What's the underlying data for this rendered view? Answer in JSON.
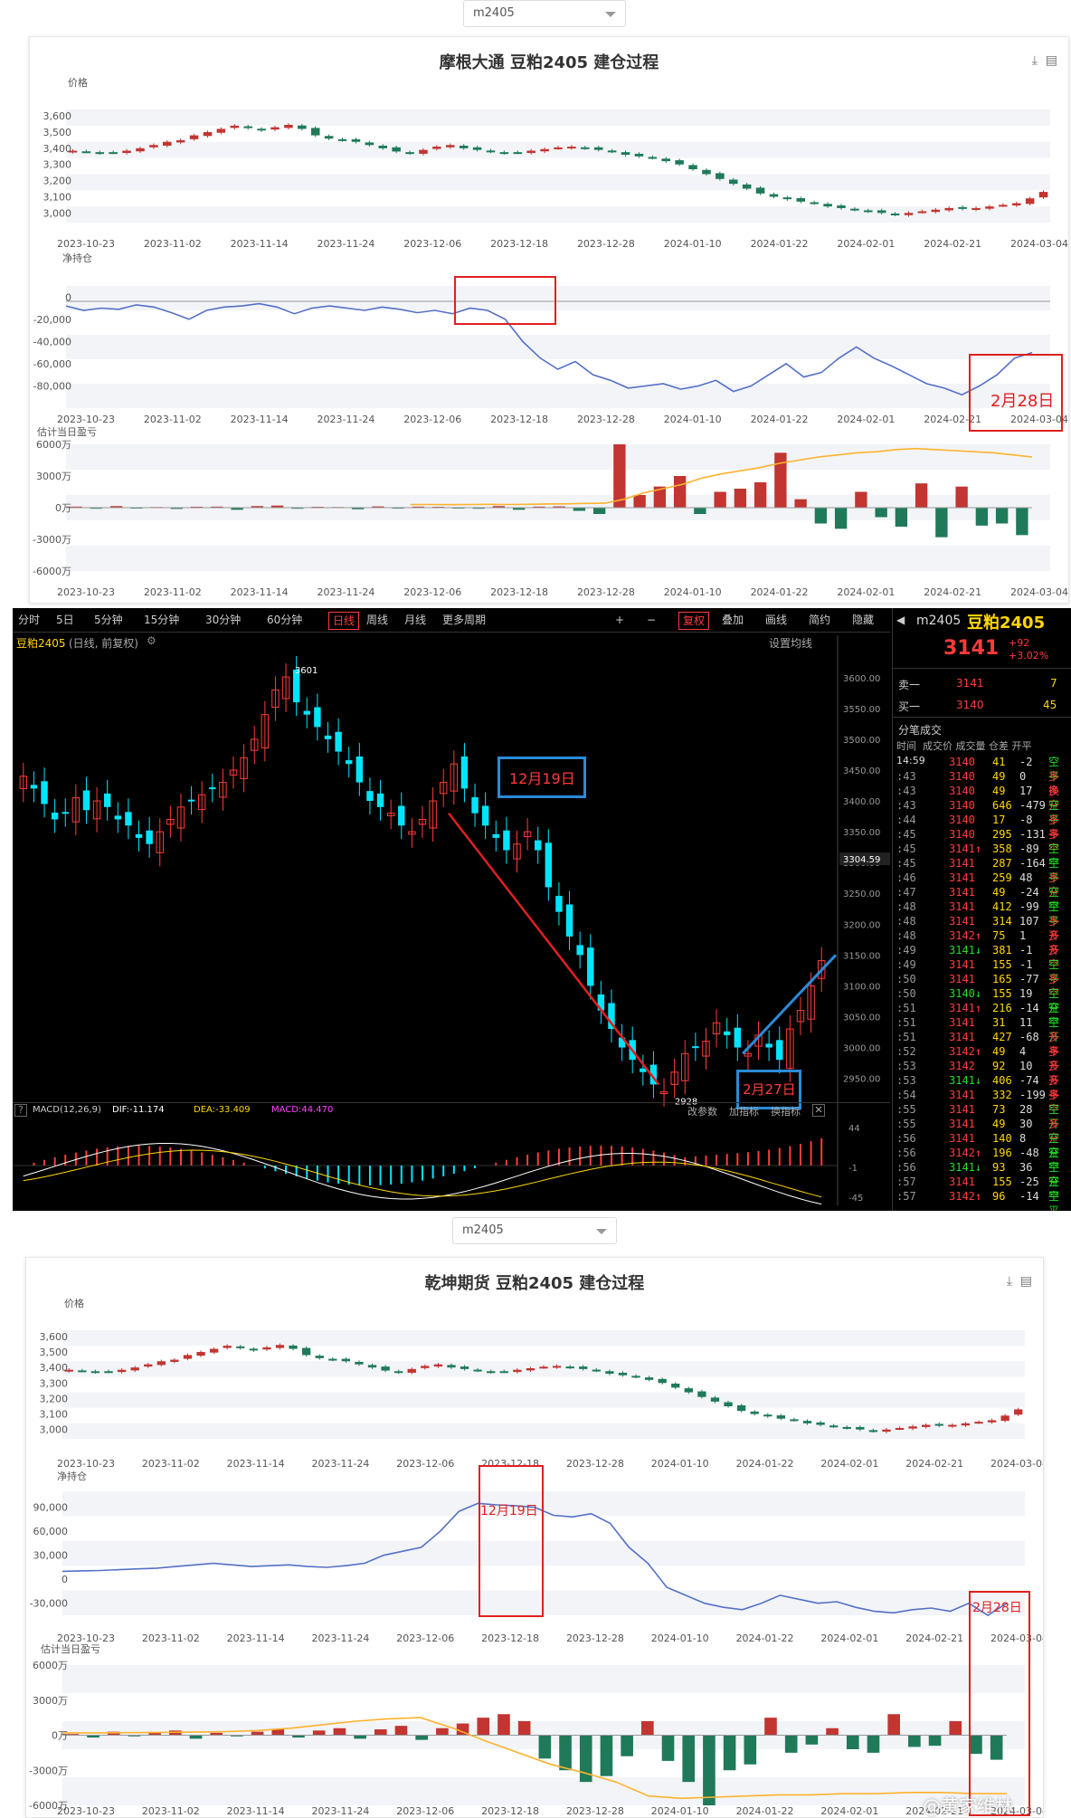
{
  "top": {
    "dropdown_value": "m2405",
    "title": "摩根大通 豆粕2405 建仓过程",
    "label_price": "价格",
    "label_net": "净持仓",
    "label_pnl": "估计当日盈亏",
    "annotation_net": "2月28日"
  },
  "bottom": {
    "dropdown_value": "m2405",
    "title": "乾坤期货 豆粕2405 建仓过程",
    "label_price": "价格",
    "label_net": "净持仓",
    "label_pnl": "估计当日盈亏",
    "annotation_a": "12月19日",
    "annotation_b": "2月28日"
  },
  "terminal": {
    "periods": [
      "分时",
      "5日",
      "5分钟",
      "15分钟",
      "30分钟",
      "60分钟",
      "日线",
      "周线",
      "月线",
      "更多周期"
    ],
    "active_period": "日线",
    "tools": [
      "+",
      "−",
      "复权",
      "叠加",
      "画线",
      "简约",
      "隐藏"
    ],
    "chart_title": "豆粕2405",
    "chart_subtitle": "(日线, 前复权)",
    "setting": "设置均线",
    "high_label": "3601",
    "low_label": "2928",
    "price_marker": "3304.59",
    "callout_a": "12月19日",
    "callout_b": "2月27日",
    "macd_label": "MACD(12,26,9)",
    "macd_dif": "DIF:-11.174",
    "macd_dea": "DEA:-33.409",
    "macd_val": "MACD:44.470",
    "macd_btns": [
      "改参数",
      "加指标",
      "换指标"
    ],
    "macd_ticks": [
      "44",
      "-1",
      "-45"
    ],
    "price_ticks": [
      "3600.00",
      "3550.00",
      "3500.00",
      "3450.00",
      "3400.00",
      "3350.00",
      "3300.00",
      "3250.00",
      "3200.00",
      "3150.00",
      "3100.00",
      "3050.00",
      "3000.00",
      "2950.00"
    ],
    "quote": {
      "code": "m2405",
      "name": "豆粕2405",
      "last": "3141",
      "change": "+92",
      "change_pct": "+3.02%",
      "sell_label": "卖一",
      "sell_price": "3141",
      "sell_vol": "7",
      "buy_label": "买一",
      "buy_price": "3140",
      "buy_vol": "45",
      "ticks_title": "分笔成交",
      "ticks_header": "时间  成交价 成交量 仓差 开平",
      "first_time": "14:59"
    },
    "ticks": [
      {
        "t": "",
        "p": "3140",
        "v": "41",
        "d": "-2",
        "k": "空平",
        "c": "red"
      },
      {
        "t": ":43",
        "p": "3140",
        "v": "49",
        "d": "0",
        "k": "多换",
        "c": "red"
      },
      {
        "t": ":43",
        "p": "3140",
        "v": "49",
        "d": "17",
        "k": "多开",
        "c": "red"
      },
      {
        "t": ":43",
        "p": "3140",
        "v": "646",
        "d": "-479",
        "k": "空平",
        "c": "red"
      },
      {
        "t": ":44",
        "p": "3140",
        "v": "17",
        "d": "-8",
        "k": "多平",
        "c": "red"
      },
      {
        "t": ":45",
        "p": "3140",
        "v": "295",
        "d": "-131",
        "k": "多平",
        "c": "red"
      },
      {
        "t": ":45",
        "p": "3141↑",
        "v": "358",
        "d": "-89",
        "k": "空平",
        "c": "red"
      },
      {
        "t": ":45",
        "p": "3141",
        "v": "287",
        "d": "-164",
        "k": "空平",
        "c": "red"
      },
      {
        "t": ":46",
        "p": "3141",
        "v": "259",
        "d": "48",
        "k": "多开",
        "c": "red"
      },
      {
        "t": ":47",
        "p": "3141",
        "v": "49",
        "d": "-24",
        "k": "空平",
        "c": "red"
      },
      {
        "t": ":48",
        "p": "3141",
        "v": "412",
        "d": "-99",
        "k": "空平",
        "c": "red"
      },
      {
        "t": ":48",
        "p": "3141",
        "v": "314",
        "d": "107",
        "k": "多开",
        "c": "red"
      },
      {
        "t": ":48",
        "p": "3142↑",
        "v": "75",
        "d": "1",
        "k": "多开",
        "c": "red"
      },
      {
        "t": ":49",
        "p": "3141↓",
        "v": "381",
        "d": "-1",
        "k": "多平",
        "c": "green"
      },
      {
        "t": ":49",
        "p": "3141",
        "v": "155",
        "d": "-1",
        "k": "空平",
        "c": "red"
      },
      {
        "t": ":50",
        "p": "3141",
        "v": "165",
        "d": "-77",
        "k": "多平",
        "c": "red"
      },
      {
        "t": ":50",
        "p": "3140↓",
        "v": "155",
        "d": "19",
        "k": "空开",
        "c": "green"
      },
      {
        "t": ":51",
        "p": "3141↑",
        "v": "216",
        "d": "-14",
        "k": "空平",
        "c": "red"
      },
      {
        "t": ":51",
        "p": "3141",
        "v": "31",
        "d": "11",
        "k": "空开",
        "c": "red"
      },
      {
        "t": ":51",
        "p": "3141",
        "v": "427",
        "d": "-68",
        "k": "多平",
        "c": "red"
      },
      {
        "t": ":52",
        "p": "3142↑",
        "v": "49",
        "d": "4",
        "k": "多开",
        "c": "red"
      },
      {
        "t": ":53",
        "p": "3142",
        "v": "92",
        "d": "10",
        "k": "多开",
        "c": "red"
      },
      {
        "t": ":53",
        "p": "3141↓",
        "v": "406",
        "d": "-74",
        "k": "多平",
        "c": "green"
      },
      {
        "t": ":54",
        "p": "3141",
        "v": "332",
        "d": "-199",
        "k": "多平",
        "c": "red"
      },
      {
        "t": ":55",
        "p": "3141",
        "v": "73",
        "d": "28",
        "k": "空开",
        "c": "red"
      },
      {
        "t": ":55",
        "p": "3141",
        "v": "49",
        "d": "30",
        "k": "多开",
        "c": "red"
      },
      {
        "t": ":56",
        "p": "3141",
        "v": "140",
        "d": "8",
        "k": "空开",
        "c": "red"
      },
      {
        "t": ":56",
        "p": "3142↑",
        "v": "196",
        "d": "-48",
        "k": "空平",
        "c": "red"
      },
      {
        "t": ":56",
        "p": "3141↓",
        "v": "93",
        "d": "36",
        "k": "空开",
        "c": "green"
      },
      {
        "t": ":57",
        "p": "3141",
        "v": "155",
        "d": "-25",
        "k": "空平",
        "c": "red"
      },
      {
        "t": ":57",
        "p": "3142↑",
        "v": "96",
        "d": "-14",
        "k": "空平",
        "c": "red"
      }
    ]
  },
  "watermark": "@黄家维林",
  "chart_data": [
    {
      "type": "line",
      "chart": "top-price",
      "title": "摩根大通 豆粕2405 建仓过程",
      "ylabel": "价格",
      "x_ticks": [
        "2023-10-23",
        "2023-11-02",
        "2023-11-14",
        "2023-11-24",
        "2023-12-06",
        "2023-12-18",
        "2023-12-28",
        "2024-01-10",
        "2024-01-22",
        "2024-02-01",
        "2024-02-21",
        "2024-03-04"
      ],
      "y_ticks": [
        3000,
        3100,
        3200,
        3300,
        3400,
        3500,
        3600
      ],
      "ylim": [
        2940,
        3640
      ],
      "close": [
        3385,
        3380,
        3370,
        3375,
        3385,
        3400,
        3420,
        3440,
        3450,
        3480,
        3500,
        3520,
        3540,
        3525,
        3510,
        3530,
        3545,
        3520,
        3480,
        3460,
        3450,
        3440,
        3420,
        3400,
        3380,
        3370,
        3390,
        3410,
        3420,
        3400,
        3390,
        3380,
        3370,
        3375,
        3385,
        3395,
        3405,
        3410,
        3400,
        3390,
        3380,
        3360,
        3350,
        3340,
        3320,
        3300,
        3270,
        3240,
        3210,
        3180,
        3150,
        3120,
        3100,
        3085,
        3070,
        3060,
        3040,
        3030,
        3020,
        3010,
        3000,
        2990,
        3000,
        3010,
        3020,
        3030,
        3025,
        3030,
        3040,
        3050,
        3060,
        3090,
        3130
      ],
      "up_color": "#c23531",
      "down_color": "#1f7a5a"
    },
    {
      "type": "line",
      "chart": "top-net",
      "ylabel": "净持仓",
      "y_ticks": [
        0,
        -20000,
        -40000,
        -60000,
        -80000
      ],
      "ylim": [
        -100000,
        10000
      ],
      "values": [
        -8000,
        -12000,
        -10000,
        -11000,
        -7000,
        -9000,
        -14000,
        -20000,
        -12000,
        -9000,
        -8000,
        -6000,
        -9000,
        -15000,
        -10000,
        -8000,
        -10000,
        -12000,
        -9000,
        -11000,
        -14000,
        -12000,
        -15000,
        -10000,
        -12000,
        -20000,
        -40000,
        -55000,
        -65000,
        -58000,
        -70000,
        -75000,
        -82000,
        -80000,
        -78000,
        -83000,
        -80000,
        -75000,
        -85000,
        -80000,
        -70000,
        -60000,
        -72000,
        -68000,
        -55000,
        -45000,
        -55000,
        -62000,
        -70000,
        -78000,
        -82000,
        -88000,
        -80000,
        -70000,
        -55000,
        -50000
      ],
      "series_color": "#5470c6"
    },
    {
      "type": "bar",
      "chart": "top-pnl",
      "ylabel": "估计当日盈亏",
      "y_ticks": [
        "6000万",
        "3000万",
        "0万",
        "-3000万",
        "-6000万"
      ],
      "ylim": [
        -6000,
        6000
      ],
      "values": [
        100,
        -100,
        150,
        -80,
        60,
        -120,
        90,
        100,
        -200,
        150,
        200,
        -100,
        80,
        60,
        -150,
        120,
        -90,
        100,
        80,
        -60,
        -100,
        150,
        -200,
        100,
        120,
        -300,
        -600,
        6000,
        1200,
        2000,
        3000,
        -600,
        1500,
        1800,
        2400,
        5200,
        800,
        -1500,
        -2000,
        1500,
        -900,
        -1800,
        2300,
        -2800,
        2000,
        -1700,
        -1500,
        -2600
      ],
      "line_color": "#ffb22c",
      "line": [
        300,
        300,
        280,
        300,
        320,
        300,
        320,
        350,
        360,
        400,
        420,
        800,
        1400,
        1800,
        2200,
        2800,
        3200,
        3500,
        3800,
        4200,
        4500,
        4800,
        5000,
        5200,
        5300,
        5500,
        5600,
        5500,
        5400,
        5300,
        5200,
        5000,
        4800
      ]
    },
    {
      "type": "line",
      "chart": "bottom-price",
      "title": "乾坤期货 豆粕2405 建仓过程",
      "ylabel": "价格",
      "y_ticks": [
        3000,
        3100,
        3200,
        3300,
        3400,
        3500,
        3600
      ],
      "ylim": [
        2940,
        3640
      ],
      "close": [
        3385,
        3380,
        3370,
        3375,
        3385,
        3400,
        3420,
        3440,
        3450,
        3480,
        3500,
        3520,
        3540,
        3525,
        3510,
        3530,
        3545,
        3520,
        3480,
        3460,
        3450,
        3440,
        3420,
        3400,
        3380,
        3370,
        3390,
        3410,
        3420,
        3400,
        3390,
        3380,
        3370,
        3375,
        3385,
        3395,
        3405,
        3410,
        3400,
        3390,
        3380,
        3360,
        3350,
        3340,
        3320,
        3300,
        3270,
        3240,
        3210,
        3180,
        3150,
        3120,
        3100,
        3085,
        3070,
        3060,
        3040,
        3030,
        3020,
        3010,
        3000,
        2990,
        3000,
        3010,
        3020,
        3030,
        3025,
        3030,
        3040,
        3050,
        3060,
        3090,
        3130
      ]
    },
    {
      "type": "line",
      "chart": "bottom-net",
      "ylabel": "净持仓",
      "y_ticks": [
        90000,
        60000,
        30000,
        0,
        -30000
      ],
      "ylim": [
        -45000,
        110000
      ],
      "values": [
        10000,
        10500,
        11000,
        12000,
        13000,
        14000,
        16000,
        18000,
        20000,
        18000,
        16000,
        17000,
        18000,
        16000,
        15000,
        17000,
        20000,
        30000,
        35000,
        40000,
        60000,
        85000,
        95000,
        93000,
        92000,
        90000,
        80000,
        78000,
        82000,
        70000,
        40000,
        20000,
        -10000,
        -20000,
        -30000,
        -35000,
        -38000,
        -30000,
        -20000,
        -25000,
        -30000,
        -28000,
        -35000,
        -40000,
        -42000,
        -38000,
        -36000,
        -40000,
        -30000,
        -45000,
        -30000
      ]
    },
    {
      "type": "bar",
      "chart": "bottom-pnl",
      "ylabel": "估计当日盈亏",
      "y_ticks": [
        "6000万",
        "3000万",
        "0万",
        "-3000万",
        "-6000万"
      ],
      "ylim": [
        -6000,
        6000
      ],
      "values": [
        100,
        -200,
        300,
        -100,
        200,
        400,
        -300,
        200,
        -100,
        300,
        500,
        -200,
        400,
        600,
        -300,
        500,
        800,
        -400,
        600,
        1000,
        1500,
        1800,
        1200,
        -2000,
        -3000,
        -4000,
        -3500,
        -1800,
        1200,
        -2200,
        -4000,
        -6000,
        -3000,
        -2500,
        1500,
        -1500,
        -800,
        600,
        -1200,
        -1500,
        1800,
        -1000,
        -900,
        1200,
        -1600,
        -2100
      ],
      "line": [
        200,
        200,
        220,
        240,
        260,
        300,
        400,
        600,
        900,
        1200,
        1400,
        1500,
        600,
        -500,
        -1500,
        -2500,
        -3200,
        -4000,
        -5200,
        -5400,
        -5300,
        -5200,
        -5100,
        -5100,
        -5000,
        -5000,
        -4900,
        -4900,
        -5000,
        -5000
      ]
    },
    {
      "type": "bar",
      "chart": "terminal-candles",
      "title": "豆粕2405",
      "subtitle": "(日线, 前复权)",
      "ylim": [
        2920,
        3610
      ],
      "y_ticks": [
        2950,
        3000,
        3050,
        3100,
        3150,
        3200,
        3250,
        3300,
        3350,
        3400,
        3450,
        3500,
        3550,
        3600
      ],
      "close": [
        3440,
        3420,
        3395,
        3370,
        3380,
        3405,
        3385,
        3400,
        3390,
        3370,
        3360,
        3340,
        3330,
        3350,
        3370,
        3390,
        3400,
        3410,
        3420,
        3430,
        3450,
        3470,
        3500,
        3540,
        3580,
        3601,
        3560,
        3540,
        3520,
        3500,
        3480,
        3460,
        3430,
        3400,
        3390,
        3380,
        3360,
        3350,
        3370,
        3400,
        3430,
        3460,
        3420,
        3380,
        3360,
        3340,
        3320,
        3330,
        3350,
        3320,
        3260,
        3220,
        3180,
        3150,
        3100,
        3060,
        3030,
        3000,
        2980,
        2960,
        2940,
        2928,
        2960,
        2990,
        3000,
        3010,
        3040,
        3020,
        3000,
        2990,
        3020,
        3000,
        2980,
        3030,
        3060,
        3100,
        3141
      ],
      "high": 3601,
      "low": 2928
    }
  ]
}
